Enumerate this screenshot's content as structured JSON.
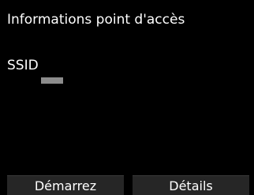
{
  "header": {
    "title": "Informations point d'accès"
  },
  "ssid": {
    "label": "SSID",
    "value_masked": true
  },
  "softkeys": {
    "left_label": "Démarrez",
    "right_label": "Détails"
  },
  "colors": {
    "background": "#000000",
    "text": "#ffffff",
    "button_bg": "#262626",
    "masked_value": "#8c8c8c"
  }
}
